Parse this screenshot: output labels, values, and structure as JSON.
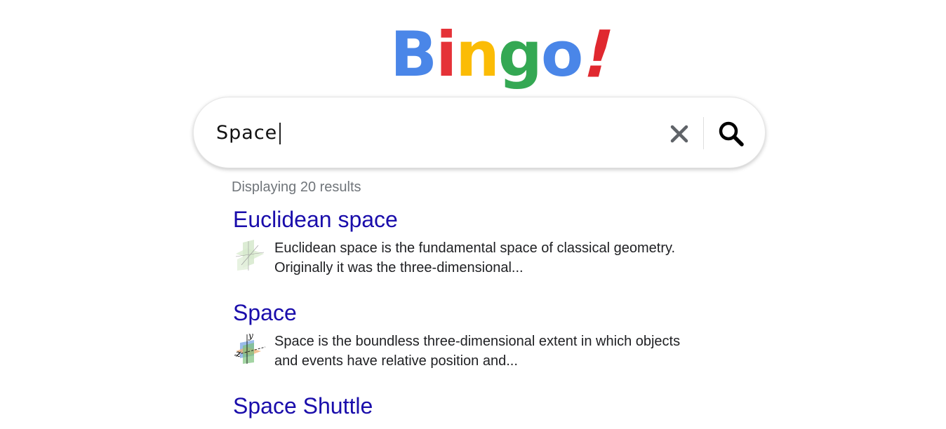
{
  "logo": {
    "letters": [
      "B",
      "i",
      "n",
      "g",
      "o",
      "!"
    ],
    "colors": [
      "#4a86e8",
      "#e53238",
      "#fbbc05",
      "#34a853",
      "#4a86e8",
      "#e0282f"
    ]
  },
  "search": {
    "value": "Space",
    "clear_icon": "close-icon",
    "search_icon": "search-icon"
  },
  "results": {
    "count_label": "Displaying 20 results",
    "items": [
      {
        "title": "Euclidean space",
        "snippet_line1": "Euclidean space is the fundamental space of classical geometry.",
        "snippet_line2": "Originally it was the three-dimensional...",
        "thumbnail": "euclidean-planes-thumbnail"
      },
      {
        "title": "Space",
        "snippet_line1": "Space is the boundless three-dimensional extent in which objects",
        "snippet_line2": "and events have relative position and...",
        "thumbnail": "3d-axes-thumbnail",
        "thumb_labels": [
          "y",
          "z"
        ]
      },
      {
        "title": "Space Shuttle"
      }
    ]
  },
  "colors": {
    "link": "#1a0dab",
    "muted": "#70757a",
    "text": "#202124"
  }
}
